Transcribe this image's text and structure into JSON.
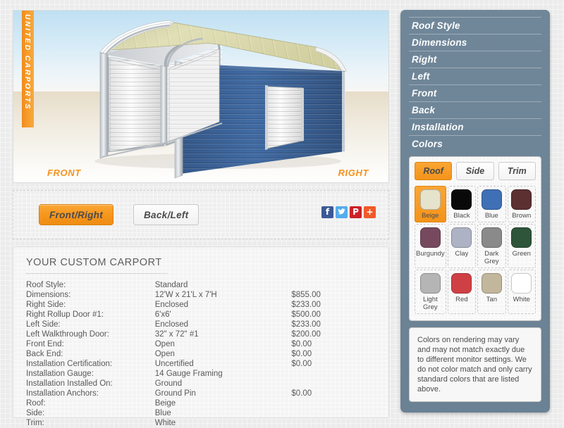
{
  "branding": {
    "vertical_logo": "UNITED CARPORTS"
  },
  "render": {
    "front_label": "FRONT",
    "right_label": "RIGHT",
    "roof_color_hex": "#d8d6a6",
    "side_color_hex": "#3a5f94",
    "trim_color_hex": "#ffffff"
  },
  "toolbar": {
    "view_front_right": "Front/Right",
    "view_back_left": "Back/Left",
    "social": [
      {
        "name": "facebook-share-icon",
        "glyph": "f",
        "color": "#3b5998"
      },
      {
        "name": "twitter-share-icon",
        "glyph": "ᵗ",
        "color": "#55acee"
      },
      {
        "name": "pinterest-share-icon",
        "glyph": "P",
        "color": "#cb2027"
      },
      {
        "name": "more-share-icon",
        "glyph": "+",
        "color": "#f05a28"
      }
    ]
  },
  "spec": {
    "title": "YOUR CUSTOM CARPORT",
    "rows": [
      {
        "label": "Roof Style:",
        "value": "Standard",
        "price": ""
      },
      {
        "label": "Dimensions:",
        "value": "12'W x 21'L x 7'H",
        "price": "$855.00"
      },
      {
        "label": "Right Side:",
        "value": "Enclosed",
        "price": "$233.00"
      },
      {
        "label": "Right Rollup Door #1:",
        "value": "6'x6'",
        "price": "$500.00"
      },
      {
        "label": "Left Side:",
        "value": "Enclosed",
        "price": "$233.00"
      },
      {
        "label": "Left Walkthrough Door:",
        "value": "32\" x 72\" #1",
        "price": "$200.00"
      },
      {
        "label": "Front End:",
        "value": "Open",
        "price": "$0.00"
      },
      {
        "label": "Back End:",
        "value": "Open",
        "price": "$0.00"
      },
      {
        "label": "Installation Certification:",
        "value": "Uncertified",
        "price": "$0.00"
      },
      {
        "label": "Installation Gauge:",
        "value": "14 Gauge Framing",
        "price": ""
      },
      {
        "label": "Installation Installed On:",
        "value": "Ground",
        "price": ""
      },
      {
        "label": "Installation Anchors:",
        "value": "Ground Pin",
        "price": "$0.00"
      },
      {
        "label": "Roof:",
        "value": "Beige",
        "price": ""
      },
      {
        "label": "Side:",
        "value": "Blue",
        "price": ""
      },
      {
        "label": "Trim:",
        "value": "White",
        "price": ""
      }
    ]
  },
  "sidebar": {
    "menu": [
      {
        "label": "Roof Style"
      },
      {
        "label": "Dimensions"
      },
      {
        "label": "Right"
      },
      {
        "label": "Left"
      },
      {
        "label": "Front"
      },
      {
        "label": "Back"
      },
      {
        "label": "Installation"
      },
      {
        "label": "Colors"
      }
    ],
    "color_tabs": [
      {
        "label": "Roof",
        "active": true
      },
      {
        "label": "Side",
        "active": false
      },
      {
        "label": "Trim",
        "active": false
      }
    ],
    "swatches": [
      {
        "label": "Beige",
        "hex": "#e6e3cd",
        "selected": true
      },
      {
        "label": "Black",
        "hex": "#090909",
        "selected": false
      },
      {
        "label": "Blue",
        "hex": "#3f6fb5",
        "selected": false
      },
      {
        "label": "Brown",
        "hex": "#5c2f30",
        "selected": false
      },
      {
        "label": "Burgundy",
        "hex": "#76495e",
        "selected": false
      },
      {
        "label": "Clay",
        "hex": "#adb3c4",
        "selected": false
      },
      {
        "label": "Dark Grey",
        "hex": "#8a8a8a",
        "selected": false
      },
      {
        "label": "Green",
        "hex": "#2e5439",
        "selected": false
      },
      {
        "label": "Light Grey",
        "hex": "#b5b5b5",
        "selected": false
      },
      {
        "label": "Red",
        "hex": "#cf4045",
        "selected": false
      },
      {
        "label": "Tan",
        "hex": "#c2b69c",
        "selected": false
      },
      {
        "label": "White",
        "hex": "#ffffff",
        "selected": false
      }
    ],
    "disclaimer": "Colors on rendering may vary and may not match exactly due to different monitor settings. We do not color match and only carry standard colors that are listed above."
  }
}
